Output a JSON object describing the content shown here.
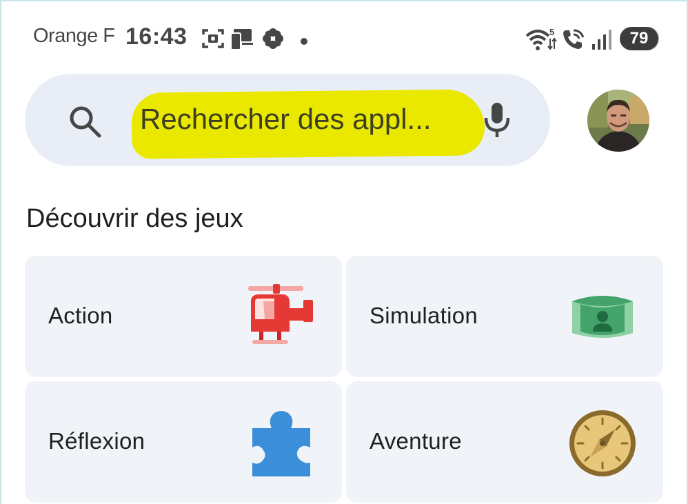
{
  "status_bar": {
    "carrier": "Orange F",
    "time": "16:43",
    "battery": "79",
    "icons": [
      "screenshot-icon",
      "devices-icon",
      "flower-icon",
      "notification-dot-icon",
      "wifi-5-icon",
      "wifi-call-icon",
      "signal-icon"
    ]
  },
  "search": {
    "placeholder": "Rechercher des appl...",
    "left_icon": "search-icon",
    "right_icon": "mic-icon"
  },
  "profile": {
    "avatar": "avatar"
  },
  "section": {
    "title": "Découvrir des jeux"
  },
  "categories": [
    {
      "label": "Action",
      "icon": "helicopter-icon"
    },
    {
      "label": "Simulation",
      "icon": "simulation-person-icon"
    },
    {
      "label": "Réflexion",
      "icon": "puzzle-icon"
    },
    {
      "label": "Aventure",
      "icon": "compass-icon"
    }
  ],
  "colors": {
    "search_bg": "#e9eef6",
    "highlight": "#ebe800",
    "tile_bg": "#f0f3f8",
    "text": "#1f1f1f",
    "helicopter_red": "#e53935",
    "simulation_green": "#43a36a",
    "puzzle_blue": "#3a8fd8",
    "compass_gold": "#e8c77a"
  }
}
